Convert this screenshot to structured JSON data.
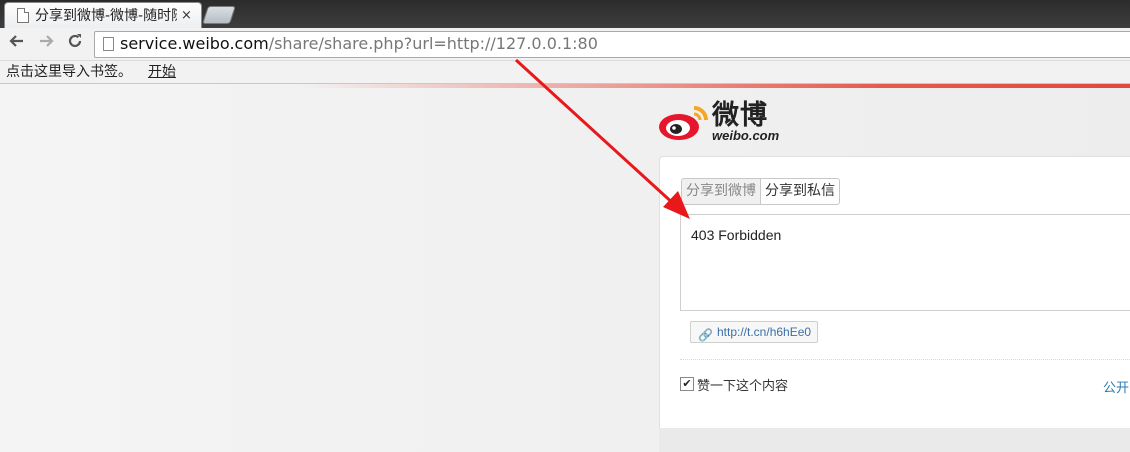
{
  "browser": {
    "tab_title": "分享到微博-微博-随时随地分享身边的新鲜事儿",
    "tab_close": "×",
    "url_host": "service.weibo.com",
    "url_path": "/share/share.php?url=http://127.0.0.1:80"
  },
  "bookmarks_bar": {
    "message": "点击这里导入书签。",
    "start_link": "开始"
  },
  "logo": {
    "word": "微博",
    "sub": "weibo.com"
  },
  "share": {
    "tabs": [
      "分享到微博",
      "分享到私信"
    ],
    "active_tab": 0,
    "text": "403 Forbidden",
    "short_link": "http://t.cn/h6hEe0",
    "like_checked": true,
    "like_label": "赞一下这个内容",
    "visibility": "公开"
  },
  "colors": {
    "accent_red": "#e0493b",
    "link_blue": "#3a6fa8",
    "arrow_red": "#e8181b"
  },
  "icons": [
    "page-icon",
    "back-icon",
    "forward-icon",
    "reload-icon",
    "link-icon",
    "weibo-eye-icon"
  ]
}
